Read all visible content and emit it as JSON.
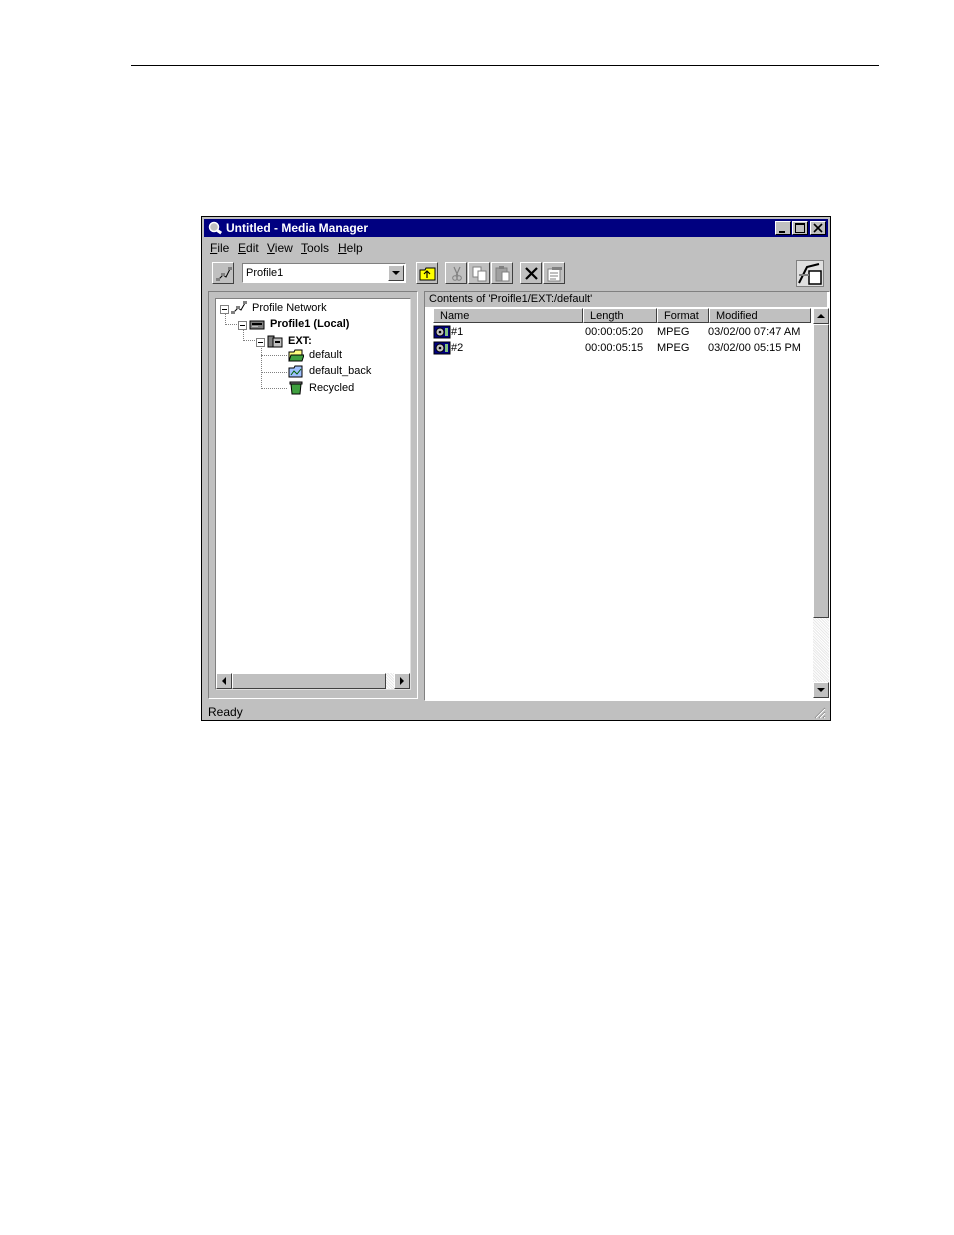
{
  "window": {
    "title": "Untitled - Media Manager"
  },
  "menu": {
    "items": [
      {
        "first": "F",
        "rest": "ile"
      },
      {
        "first": "E",
        "rest": "dit"
      },
      {
        "first": "V",
        "rest": "iew"
      },
      {
        "first": "T",
        "rest": "ools"
      },
      {
        "first": "H",
        "rest": "elp"
      }
    ]
  },
  "toolbar": {
    "machine_select": "Profile1"
  },
  "tree": {
    "root": "Profile Network",
    "machine": "Profile1 (Local)",
    "volume": "EXT:",
    "bins": [
      "default",
      "default_back",
      "Recycled"
    ]
  },
  "list": {
    "caption": "Contents of 'Proifle1/EXT:/default'",
    "columns": [
      "Name",
      "Length",
      "Format",
      "Modified"
    ],
    "rows": [
      {
        "name": "#1",
        "length": "00:00:05:20",
        "format": "MPEG",
        "modified": "03/02/00 07:47 AM"
      },
      {
        "name": "#2",
        "length": "00:00:05:15",
        "format": "MPEG",
        "modified": "03/02/00 05:15 PM"
      }
    ]
  },
  "status": {
    "text": "Ready"
  },
  "colors": {
    "titlebar": "#000080",
    "face": "#c0c0c0"
  }
}
